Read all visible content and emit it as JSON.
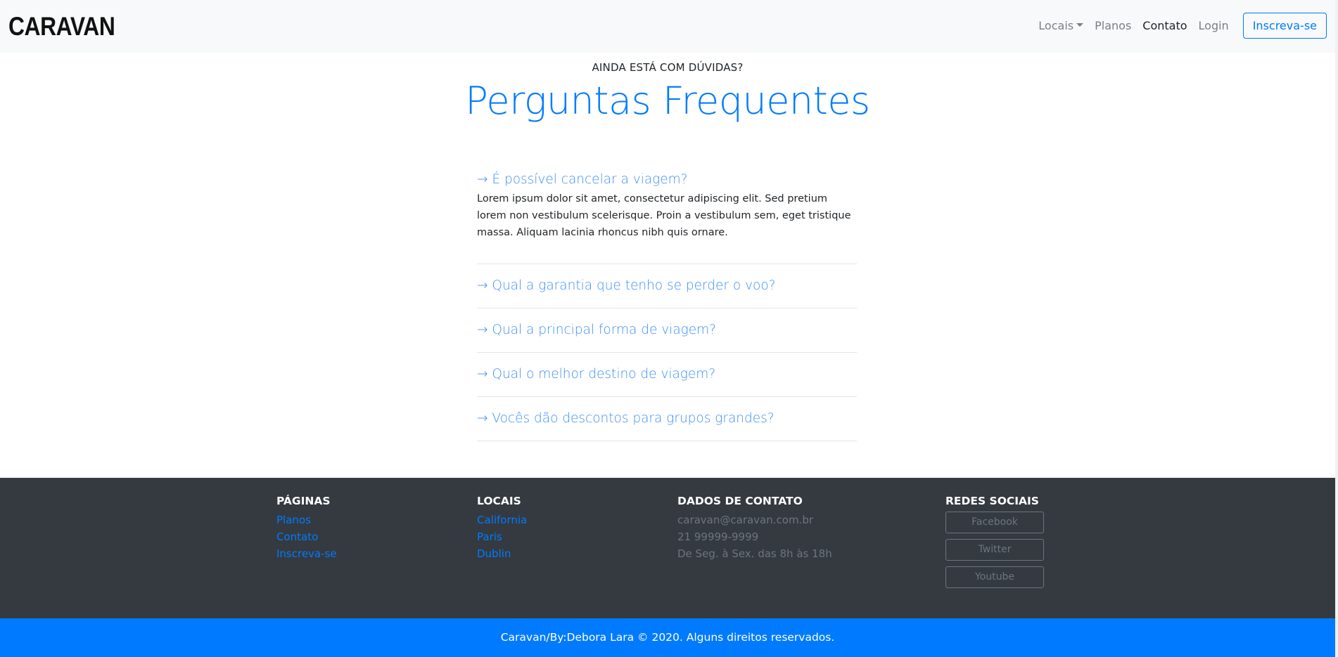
{
  "navbar": {
    "brand": "CARAVAN",
    "links": {
      "locais": "Locais",
      "planos": "Planos",
      "contato": "Contato",
      "login": "Login"
    },
    "signup_label": "Inscreva-se"
  },
  "faq": {
    "eyebrow": "AINDA ESTÁ COM DÚVIDAS?",
    "title": "Perguntas Frequentes",
    "items": [
      {
        "question": "→ É possível cancelar a viagem?",
        "answer": "Lorem ipsum dolor sit amet, consectetur adipiscing elit. Sed pretium lorem non vestibulum scelerisque. Proin a vestibulum sem, eget tristique massa. Aliquam lacinia rhoncus nibh quis ornare."
      },
      {
        "question": "→ Qual a garantia que tenho se perder o voo?"
      },
      {
        "question": "→ Qual a principal forma de viagem?"
      },
      {
        "question": "→ Qual o melhor destino de viagem?"
      },
      {
        "question": "→ Vocês dão descontos para grupos grandes?"
      }
    ]
  },
  "footer": {
    "paginas": {
      "heading": "PÁGINAS",
      "links": [
        "Planos",
        "Contato",
        "Inscreva-se"
      ]
    },
    "locais": {
      "heading": "LOCAIS",
      "links": [
        "California",
        "Paris",
        "Dublin"
      ]
    },
    "contato": {
      "heading": "DADOS DE CONTATO",
      "email": "caravan@caravan.com.br",
      "phone": "21 99999-9999",
      "hours": "De Seg. à Sex. das 8h às 18h"
    },
    "social": {
      "heading": "REDES SOCIAIS",
      "buttons": [
        "Facebook",
        "Twitter",
        "Youtube"
      ]
    }
  },
  "copyright": "Caravan/By:Debora Lara © 2020. Alguns direitos reservados.",
  "colors": {
    "accent": "#007bff",
    "footer_bg": "#343a40",
    "navbar_bg": "#f8f9fa"
  }
}
